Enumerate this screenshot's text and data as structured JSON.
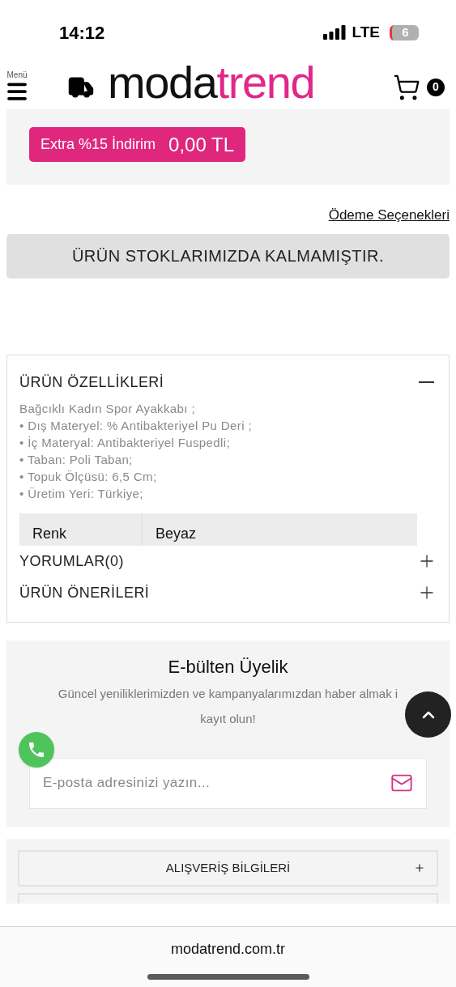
{
  "status_bar": {
    "time": "14:12",
    "network": "LTE",
    "battery": "6"
  },
  "header": {
    "menu_label": "Menü",
    "logo": {
      "dark": "moda",
      "accent": "trend"
    },
    "cart_count": "0"
  },
  "discount": {
    "label": "Extra %15 İndirim",
    "amount": "0,00 TL"
  },
  "payment_link": "Ödeme Seçenekleri",
  "stock_notice": "ÜRÜN STOKLARIMIZDA KALMAMIŞTIR.",
  "accordion": [
    {
      "title": "ÜRÜN ÖZELLİKLERİ",
      "expanded": true,
      "lines": [
        "Bağcıklı Kadın Spor Ayakkabı ;",
        "• Dış Materyel: % Antibakteriyel Pu Deri ;",
        "• İç Materyal: Antibakteriyel Fuspedli;",
        "• Taban: Poli Taban;",
        "• Topuk Ölçüsü: 6,5 Cm;",
        "• Üretim Yeri: Türkiye;"
      ],
      "table": [
        [
          "Renk",
          "Beyaz"
        ]
      ]
    },
    {
      "title": "YORUMLAR(0)",
      "expanded": false
    },
    {
      "title": "ÜRÜN ÖNERİLERİ",
      "expanded": false
    }
  ],
  "newsletter": {
    "title": "E-bülten Üyelik",
    "lines": [
      "Güncel yeniliklerimizden ve kampanyalarımızdan haber almak i",
      "kayıt olun!"
    ],
    "placeholder": "E-posta adresinizi yazın..."
  },
  "footer_sections": [
    {
      "title": "ALIŞVERİŞ BİLGİLERİ",
      "expanded": false
    }
  ],
  "browser": {
    "url": "modatrend.com.tr"
  }
}
